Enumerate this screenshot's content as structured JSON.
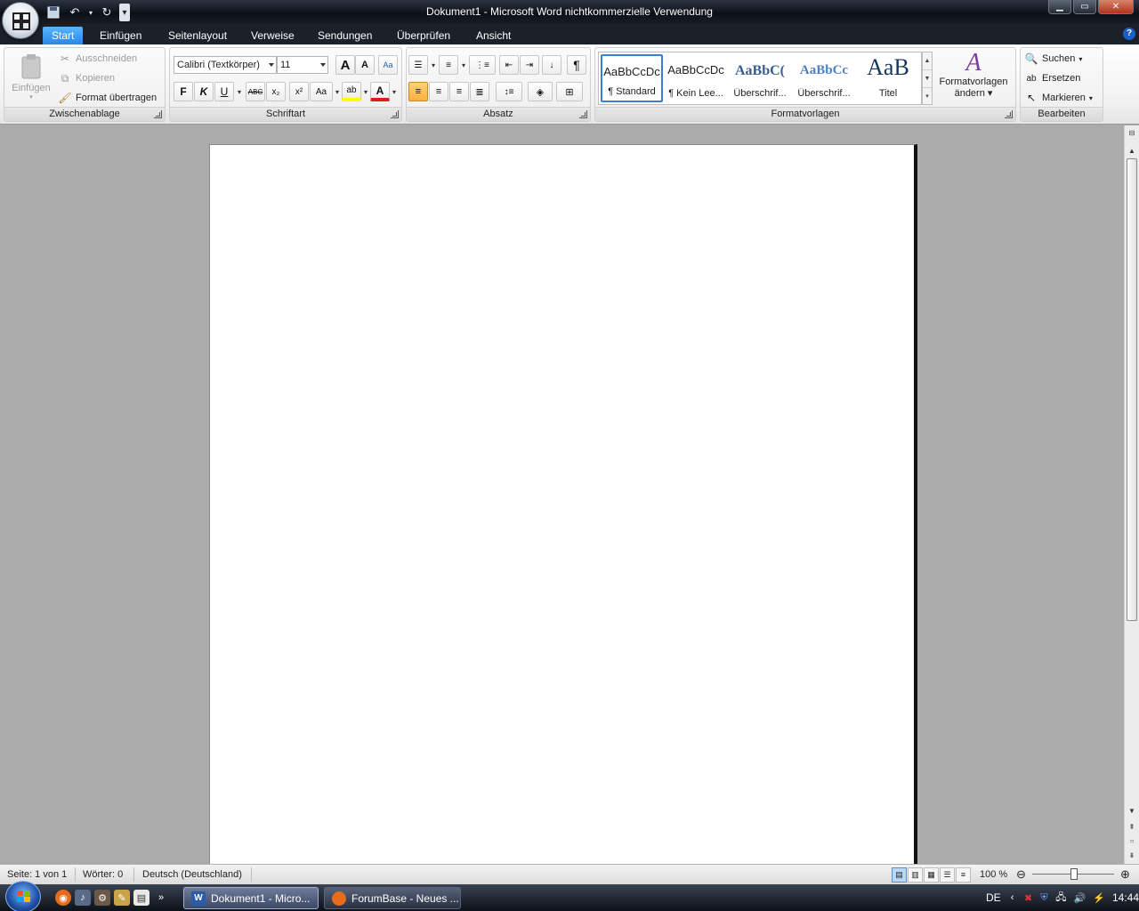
{
  "window": {
    "title": "Dokument1 - Microsoft Word nichtkommerzielle Verwendung"
  },
  "quick_access": {
    "save_icon": "save-icon",
    "undo_icon": "undo-icon",
    "redo_icon": "redo-icon",
    "customize_icon": "customize-icon"
  },
  "tabs": [
    {
      "label": "Start",
      "active": true
    },
    {
      "label": "Einfügen"
    },
    {
      "label": "Seitenlayout"
    },
    {
      "label": "Verweise"
    },
    {
      "label": "Sendungen"
    },
    {
      "label": "Überprüfen"
    },
    {
      "label": "Ansicht"
    }
  ],
  "help_label": "?",
  "clipboard": {
    "label": "Zwischenablage",
    "paste": "Einfügen",
    "cut": "Ausschneiden",
    "copy": "Kopieren",
    "format_painter": "Format übertragen"
  },
  "font": {
    "label": "Schriftart",
    "name": "Calibri (Textkörper)",
    "size": "11",
    "bold": "F",
    "italic": "K",
    "underline": "U",
    "strikethrough": "ABC",
    "subscript": "x₂",
    "superscript": "x²",
    "change_case": "Aa",
    "highlight": "ab",
    "font_color": "A"
  },
  "paragraph": {
    "label": "Absatz",
    "show_marks": "¶"
  },
  "styles": {
    "label": "Formatvorlagen",
    "items": [
      {
        "sample": "AaBbCcDc",
        "name": "¶ Standard",
        "selected": true
      },
      {
        "sample": "AaBbCcDc",
        "name": "¶ Kein Lee..."
      },
      {
        "sample": "AaBbC(",
        "name": "Überschrif..."
      },
      {
        "sample": "AaBbCc",
        "name": "Überschrif..."
      },
      {
        "sample": "AaB",
        "name": "Titel"
      }
    ],
    "change_styles_line1": "Formatvorlagen",
    "change_styles_line2": "ändern"
  },
  "editing": {
    "label": "Bearbeiten",
    "find": "Suchen",
    "replace": "Ersetzen",
    "select": "Markieren"
  },
  "status": {
    "page": "Seite: 1 von 1",
    "words": "Wörter: 0",
    "language": "Deutsch (Deutschland)",
    "zoom": "100 %"
  },
  "taskbar": {
    "buttons": [
      {
        "label": "Dokument1 - Micro...",
        "active": true
      },
      {
        "label": "ForumBase - Neues ..."
      }
    ],
    "lang": "DE",
    "clock": "14:44"
  },
  "colors": {
    "accent_tab": "#2887e2",
    "selected_style": "#3a7fd6",
    "highlight_yellow": "#ffff00",
    "font_red": "#e01b1b"
  }
}
